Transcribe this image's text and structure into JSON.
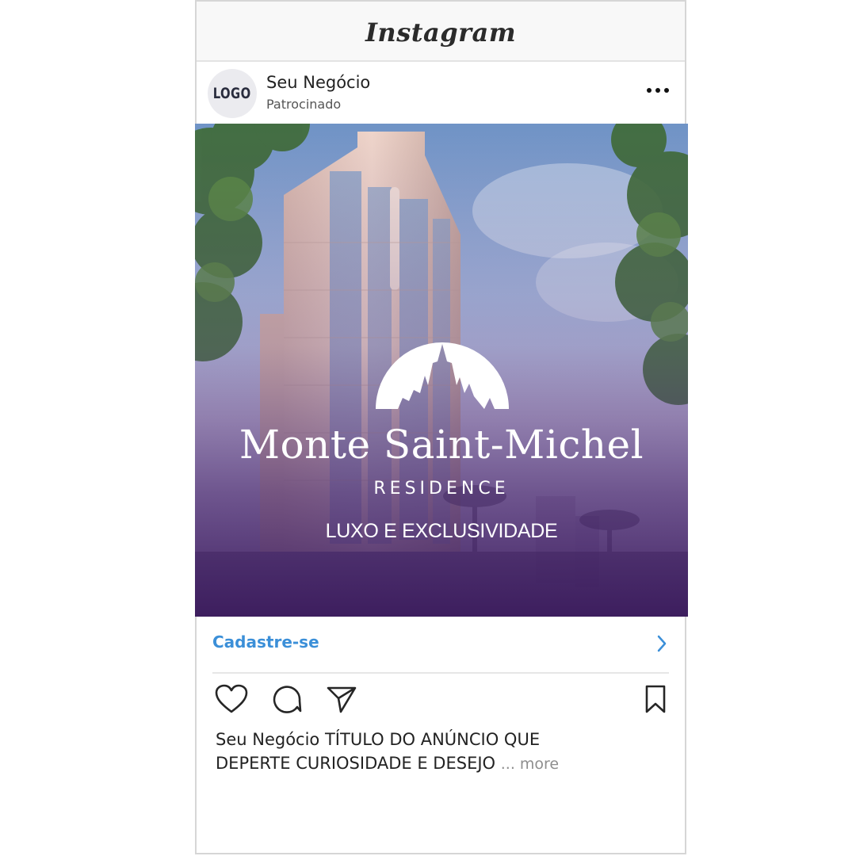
{
  "app": {
    "name": "Instagram"
  },
  "post": {
    "avatar_text": "LOGO",
    "account_name": "Seu Negócio",
    "sponsored_label": "Patrocinado"
  },
  "ad": {
    "brand_title": "Monte Saint-Michel",
    "brand_subtitle": "RESIDENCE",
    "tagline": "LUXO E EXCLUSIVIDADE"
  },
  "cta": {
    "label": "Cadastre-se"
  },
  "caption": {
    "username": "Seu Negócio",
    "line1": "TÍTULO DO ANÚNCIO QUE",
    "line2": "DEPERTE CURIOSIDADE E DESEJO",
    "more_label": "... more"
  },
  "colors": {
    "accent_link": "#3b8fd8",
    "overlay_purple": "#4a2a6e"
  },
  "icons": [
    "more-horizontal-icon",
    "chevron-right-icon",
    "heart-icon",
    "comment-icon",
    "share-icon",
    "bookmark-icon",
    "skyline-logo-icon"
  ]
}
